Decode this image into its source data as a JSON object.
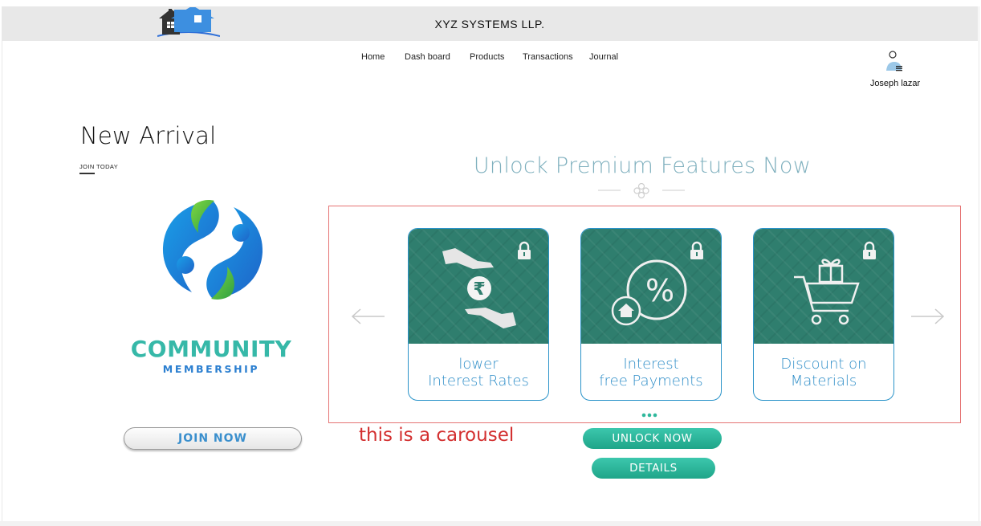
{
  "header": {
    "title": "XYZ  SYSTEMS LLP.",
    "logo_icon": "house-logo-icon"
  },
  "nav": {
    "items": [
      {
        "label": "Home"
      },
      {
        "label": "Dash board"
      },
      {
        "label": "Products"
      },
      {
        "label": "Transactions"
      },
      {
        "label": "Journal"
      }
    ]
  },
  "user": {
    "name": "Joseph lazar",
    "icon": "user-avatar-icon"
  },
  "new_arrival": {
    "title": "New Arrival",
    "subtitle": "JOIN TODAY",
    "brand_word_1": "COMMUNITY",
    "brand_word_2": "MEMBERSHIP",
    "join_button": "JOIN NOW"
  },
  "premium": {
    "heading": "Unlock Premium Features Now",
    "cards": [
      {
        "label": "lower\nInterest Rates",
        "icon": "hand-rupee-icon"
      },
      {
        "label": "Interest\nfree Payments",
        "icon": "percent-badge-icon"
      },
      {
        "label": "Discount on\nMaterials",
        "icon": "shopping-cart-gift-icon"
      }
    ],
    "carousel_note": "this is a carousel",
    "unlock_button": "UNLOCK NOW",
    "details_button": "DETAILS"
  },
  "colors": {
    "card_bg": "#2f7e6e",
    "card_border": "#2a93c9",
    "accent": "#2fb89c",
    "heading": "#7fb0be",
    "annotation": "#d32f2f"
  }
}
